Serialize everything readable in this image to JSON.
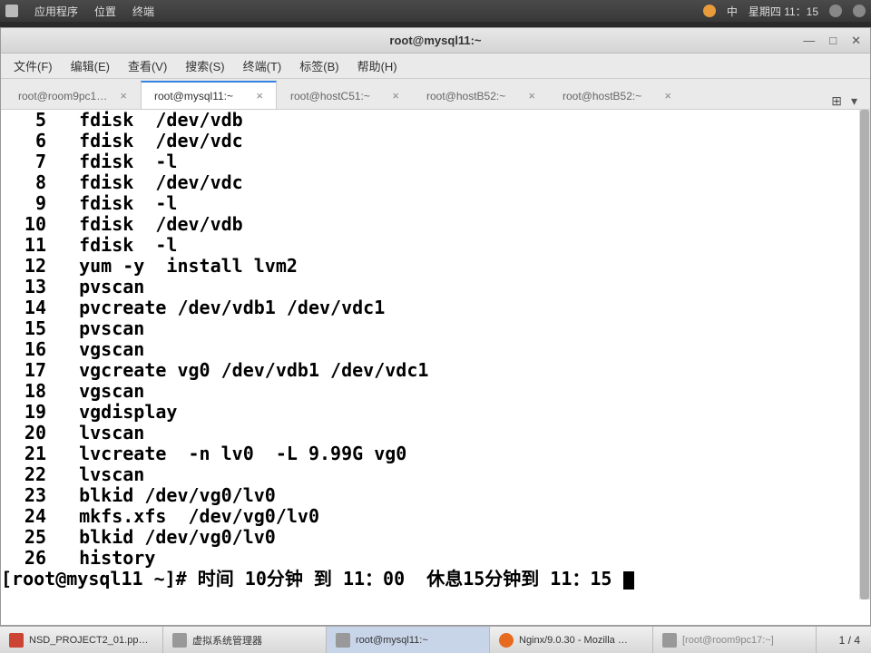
{
  "top_panel": {
    "apps": "应用程序",
    "places": "位置",
    "terminal": "终端",
    "ime": "中",
    "date": "星期四 11：15"
  },
  "window": {
    "title": "root@mysql11:~"
  },
  "menubar": {
    "file": "文件(F)",
    "edit": "编辑(E)",
    "view": "查看(V)",
    "search": "搜索(S)",
    "terminal": "终端(T)",
    "tabs": "标签(B)",
    "help": "帮助(H)"
  },
  "tabs": [
    {
      "label": "root@room9pc1…",
      "active": false
    },
    {
      "label": "root@mysql11:~",
      "active": true
    },
    {
      "label": "root@hostC51:~",
      "active": false
    },
    {
      "label": "root@hostB52:~",
      "active": false
    },
    {
      "label": "root@hostB52:~",
      "active": false
    }
  ],
  "history": [
    {
      "n": "5",
      "cmd": "fdisk  /dev/vdb"
    },
    {
      "n": "6",
      "cmd": "fdisk  /dev/vdc"
    },
    {
      "n": "7",
      "cmd": "fdisk  -l"
    },
    {
      "n": "8",
      "cmd": "fdisk  /dev/vdc"
    },
    {
      "n": "9",
      "cmd": "fdisk  -l"
    },
    {
      "n": "10",
      "cmd": "fdisk  /dev/vdb"
    },
    {
      "n": "11",
      "cmd": "fdisk  -l"
    },
    {
      "n": "12",
      "cmd": "yum -y  install lvm2"
    },
    {
      "n": "13",
      "cmd": "pvscan"
    },
    {
      "n": "14",
      "cmd": "pvcreate /dev/vdb1 /dev/vdc1"
    },
    {
      "n": "15",
      "cmd": "pvscan"
    },
    {
      "n": "16",
      "cmd": "vgscan"
    },
    {
      "n": "17",
      "cmd": "vgcreate vg0 /dev/vdb1 /dev/vdc1"
    },
    {
      "n": "18",
      "cmd": "vgscan"
    },
    {
      "n": "19",
      "cmd": "vgdisplay"
    },
    {
      "n": "20",
      "cmd": "lvscan"
    },
    {
      "n": "21",
      "cmd": "lvcreate  -n lv0  -L 9.99G vg0"
    },
    {
      "n": "22",
      "cmd": "lvscan"
    },
    {
      "n": "23",
      "cmd": "blkid /dev/vg0/lv0"
    },
    {
      "n": "24",
      "cmd": "mkfs.xfs  /dev/vg0/lv0"
    },
    {
      "n": "25",
      "cmd": "blkid /dev/vg0/lv0"
    },
    {
      "n": "26",
      "cmd": "history"
    }
  ],
  "prompt": "[root@mysql11 ~]# 时间 10分钟 到 11：00  休息15分钟到 11：15 ",
  "taskbar": {
    "items": [
      {
        "label": "NSD_PROJECT2_01.pp…",
        "cls": "red"
      },
      {
        "label": "虚拟系统管理器",
        "cls": "grey"
      },
      {
        "label": "root@mysql11:~",
        "cls": "grey",
        "active": true
      },
      {
        "label": "Nginx/9.0.30 - Mozilla …",
        "cls": "ff"
      },
      {
        "label": "[root@room9pc17:~]",
        "cls": "grey",
        "dim": true
      }
    ],
    "pager": "1 / 4"
  }
}
